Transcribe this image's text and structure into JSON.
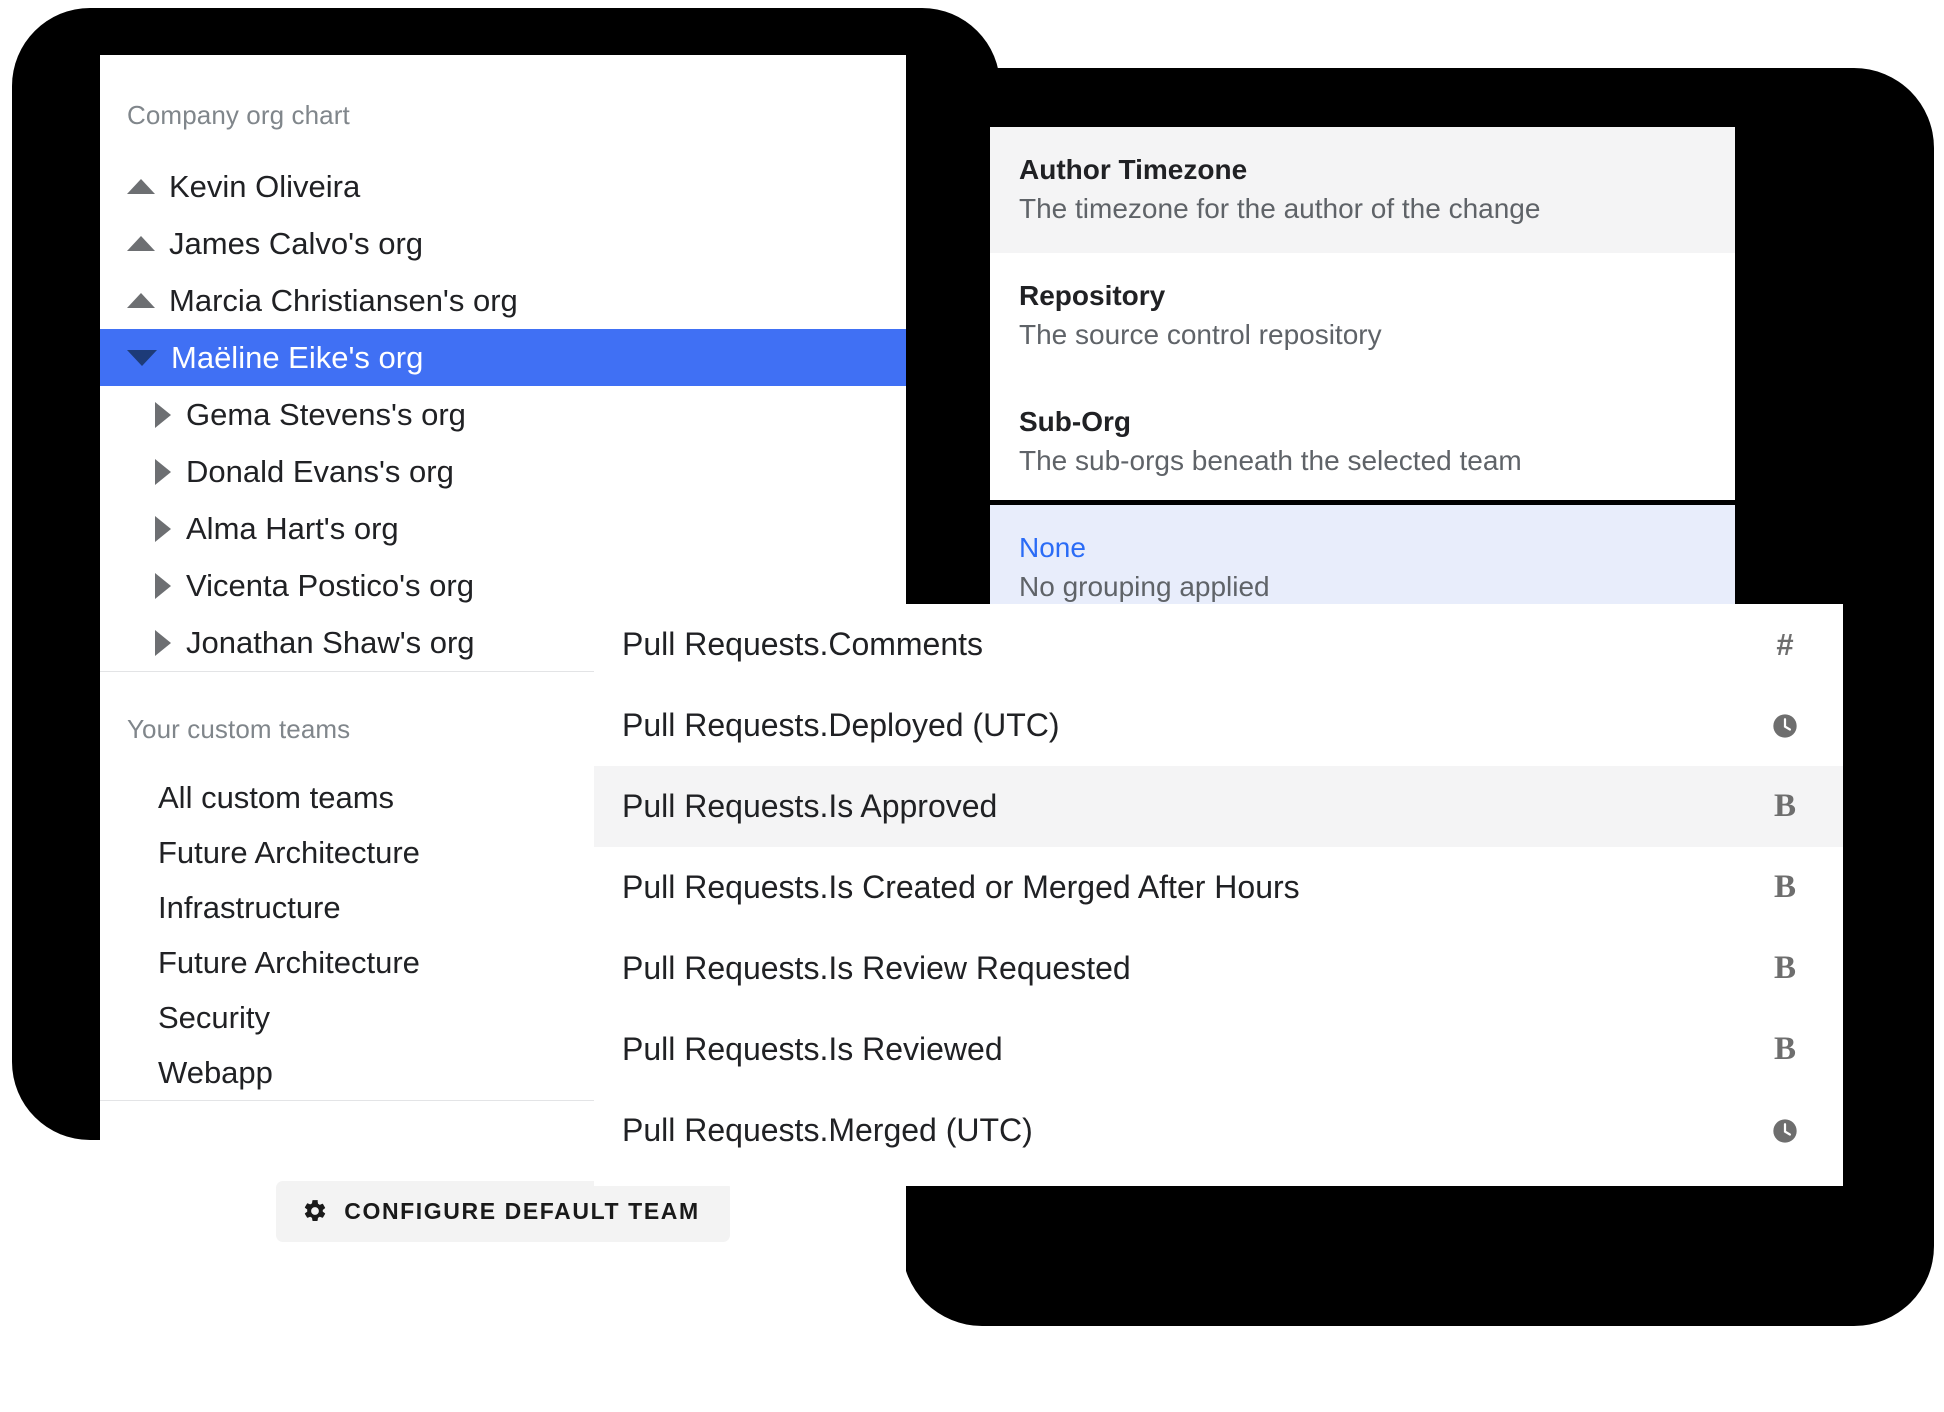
{
  "colors": {
    "accent_blue": "#4070f4",
    "selected_text_blue": "#2b6cf6",
    "selected_row_bg": "#e8edfb",
    "hover_bg": "#f4f4f5",
    "frame_black": "#000000",
    "muted_text": "#5f6368"
  },
  "team_panel": {
    "org_section": {
      "label": "Company org chart",
      "items": [
        {
          "label": "Kevin Oliveira",
          "icon": "triangle-up-icon",
          "level": 0,
          "state": "collapsed",
          "selected": false
        },
        {
          "label": "James Calvo's org",
          "icon": "triangle-up-icon",
          "level": 0,
          "state": "collapsed",
          "selected": false
        },
        {
          "label": "Marcia Christiansen's org",
          "icon": "triangle-up-icon",
          "level": 0,
          "state": "collapsed",
          "selected": false
        },
        {
          "label": "Maëline Eike's org",
          "icon": "triangle-down-icon",
          "level": 0,
          "state": "expanded",
          "selected": true
        },
        {
          "label": "Gema Stevens's org",
          "icon": "triangle-right-icon",
          "level": 1,
          "state": "collapsed",
          "selected": false
        },
        {
          "label": "Donald Evans's org",
          "icon": "triangle-right-icon",
          "level": 1,
          "state": "collapsed",
          "selected": false
        },
        {
          "label": "Alma Hart's org",
          "icon": "triangle-right-icon",
          "level": 1,
          "state": "collapsed",
          "selected": false
        },
        {
          "label": "Vicenta Postico's org",
          "icon": "triangle-right-icon",
          "level": 1,
          "state": "collapsed",
          "selected": false
        },
        {
          "label": "Jonathan Shaw's org",
          "icon": "triangle-right-icon",
          "level": 1,
          "state": "collapsed",
          "selected": false
        }
      ]
    },
    "custom_section": {
      "label": "Your custom teams",
      "items": [
        {
          "label": "All custom teams"
        },
        {
          "label": "Future Architecture"
        },
        {
          "label": "Infrastructure"
        },
        {
          "label": "Future Architecture"
        },
        {
          "label": "Security"
        },
        {
          "label": "Webapp"
        }
      ]
    },
    "footer": {
      "configure_button_label": "CONFIGURE DEFAULT TEAM",
      "configure_button_icon": "gear-icon"
    }
  },
  "grouping_panel": {
    "options": [
      {
        "title": "Author Timezone",
        "description": "The timezone for the author of the change",
        "state": "hovered"
      },
      {
        "title": "Repository",
        "description": "The source control repository",
        "state": "normal"
      },
      {
        "title": "Sub-Org",
        "description": "The sub-orgs beneath the selected team",
        "state": "normal"
      },
      {
        "title": "None",
        "description": "No grouping applied",
        "state": "selected"
      }
    ]
  },
  "field_dropdown": {
    "rows": [
      {
        "label": "Pull Requests.Comments",
        "type": "number",
        "type_glyph": "#",
        "icon": "hash-icon",
        "state": "normal"
      },
      {
        "label": "Pull Requests.Deployed (UTC)",
        "type": "datetime",
        "type_glyph": "",
        "icon": "clock-icon",
        "state": "normal"
      },
      {
        "label": "Pull Requests.Is Approved",
        "type": "boolean",
        "type_glyph": "B",
        "icon": "boolean-icon",
        "state": "hovered"
      },
      {
        "label": "Pull Requests.Is Created or Merged After Hours",
        "type": "boolean",
        "type_glyph": "B",
        "icon": "boolean-icon",
        "state": "normal"
      },
      {
        "label": "Pull Requests.Is Review Requested",
        "type": "boolean",
        "type_glyph": "B",
        "icon": "boolean-icon",
        "state": "normal"
      },
      {
        "label": "Pull Requests.Is Reviewed",
        "type": "boolean",
        "type_glyph": "B",
        "icon": "boolean-icon",
        "state": "normal"
      },
      {
        "label": "Pull Requests.Merged (UTC)",
        "type": "datetime",
        "type_glyph": "",
        "icon": "clock-icon",
        "state": "normal"
      }
    ]
  }
}
